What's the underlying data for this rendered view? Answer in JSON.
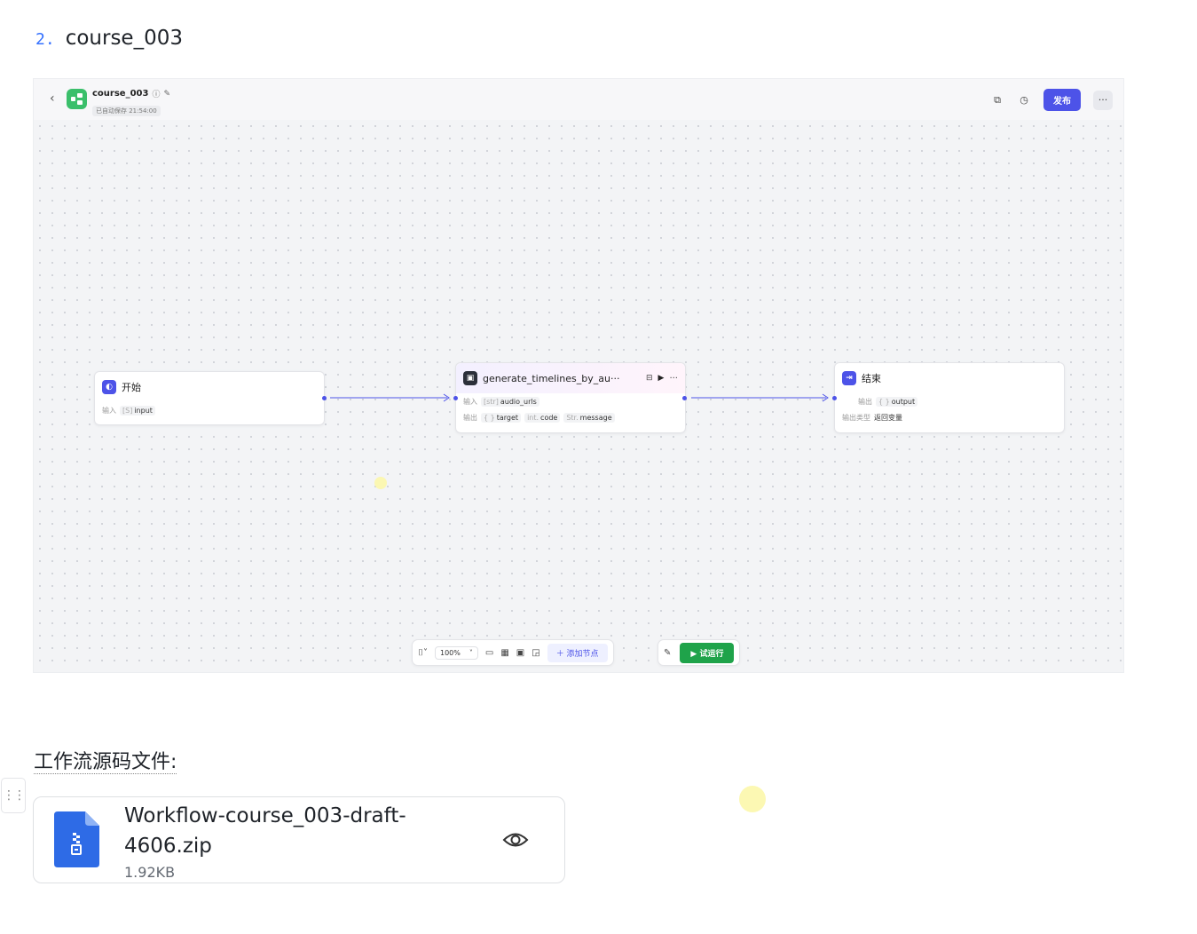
{
  "heading": {
    "number": "2.",
    "title": "course_003"
  },
  "workflow": {
    "name": "course_003",
    "saved_status": "已自动保存 21:54:00",
    "publish_label": "发布",
    "more_label": "···"
  },
  "nodes": {
    "start": {
      "title": "开始",
      "input_label": "输入",
      "input_type": "[S]",
      "input_name": "input"
    },
    "plugin": {
      "title": "generate_timelines_by_au···",
      "input_label": "输入",
      "input_type": "[str]",
      "input_name": "audio_urls",
      "output_label": "输出",
      "outputs": [
        {
          "type": "{ }",
          "name": "target"
        },
        {
          "type": "int.",
          "name": "code"
        },
        {
          "type": "Str.",
          "name": "message"
        }
      ]
    },
    "end": {
      "title": "结束",
      "output_label": "输出",
      "output_type": "{ }",
      "output_name": "output",
      "output_kind_label": "输出类型",
      "output_kind_value": "返回变量"
    }
  },
  "bottom_toolbar": {
    "zoom": "100%",
    "add_node_label": "＋ 添加节点",
    "run_label": "▶ 试运行"
  },
  "file_section": {
    "label": "工作流源码文件:",
    "file_name": "Workflow-course_003-draft-4606.zip",
    "file_size": "1.92KB"
  },
  "colors": {
    "accent": "#4d53e8",
    "run_green": "#1fa34a",
    "app_icon": "#3bbf6b",
    "file_icon": "#2e6be6",
    "link_blue": "#3370ff"
  }
}
